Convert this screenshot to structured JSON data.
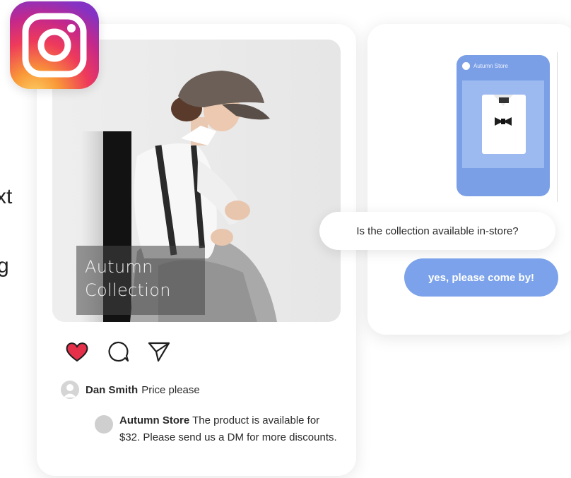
{
  "post": {
    "overlay_line1": "Autumn",
    "overlay_line2": "Collection",
    "comments": [
      {
        "name": "Dan Smith",
        "text": "Price please"
      },
      {
        "name": "Autumn Store",
        "text": "The product is available for $32. Please send us a DM for more discounts."
      }
    ]
  },
  "dm": {
    "story_label": "Autumn Store",
    "question": "Is the collection available in-store?",
    "reply": "yes, please come by!"
  },
  "colors": {
    "like_red": "#e5304a",
    "reply_blue": "#7ba2ea",
    "story_blue": "#7a9fe6"
  },
  "icons": [
    "instagram-logo-icon",
    "heart-icon",
    "comment-icon",
    "share-icon",
    "user-avatar-icon"
  ]
}
